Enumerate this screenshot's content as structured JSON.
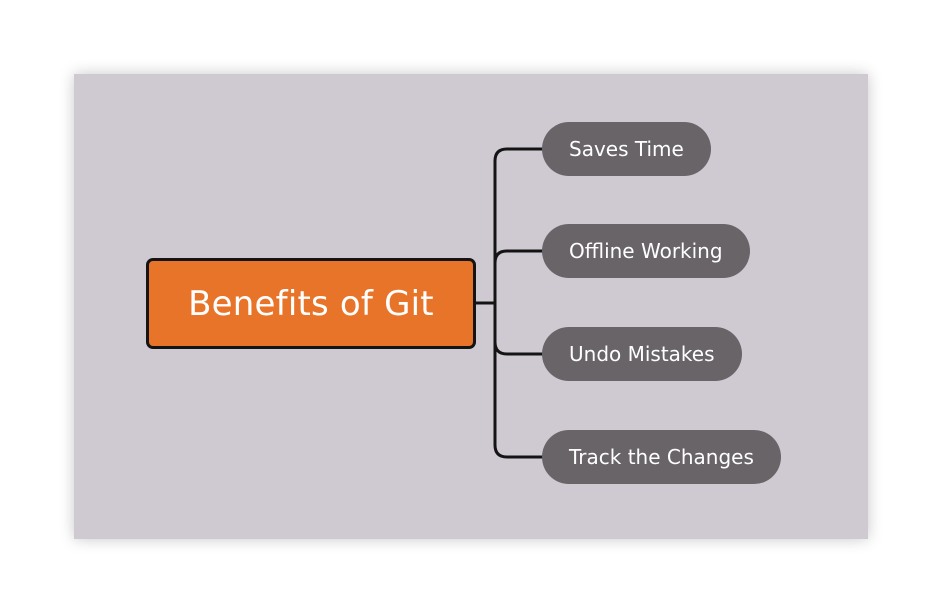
{
  "diagram": {
    "root": {
      "label": "Benefits of Git"
    },
    "branches": [
      {
        "label": "Saves Time"
      },
      {
        "label": "Offline Working"
      },
      {
        "label": "Undo Mistakes"
      },
      {
        "label": "Track the Changes"
      }
    ]
  },
  "colors": {
    "background": "#cfcad1",
    "root_fill": "#e8742a",
    "root_border": "#141414",
    "branch_fill": "#686468",
    "connector": "#141414",
    "text": "#ffffff"
  }
}
